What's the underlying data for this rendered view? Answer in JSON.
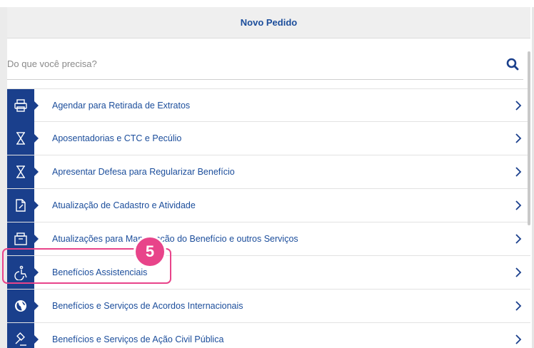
{
  "header": {
    "title": "Novo Pedido"
  },
  "search": {
    "placeholder": "Do que você precisa?"
  },
  "services": [
    {
      "label": "Agendar para Retirada de Extratos",
      "icon": "printer-icon"
    },
    {
      "label": "Aposentadorias e CTC e Pecúlio",
      "icon": "hourglass-icon"
    },
    {
      "label": "Apresentar Defesa para Regularizar Benefício",
      "icon": "hourglass-icon"
    },
    {
      "label": "Atualização de Cadastro e Atividade",
      "icon": "document-edit-icon"
    },
    {
      "label": "Atualizações para Manutenção do Benefício e outros Serviços",
      "icon": "archive-box-icon"
    },
    {
      "label": "Benefícios Assistenciais",
      "icon": "wheelchair-icon"
    },
    {
      "label": "Benefícios e Serviços de Acordos Internacionais",
      "icon": "globe-icon"
    },
    {
      "label": "Benefícios e Serviços de Ação Civil Pública",
      "icon": "gavel-icon"
    }
  ],
  "annotation": {
    "step": "5",
    "color": "#e8448a"
  },
  "colors": {
    "brand": "#1a3f8c",
    "link": "#1b4d9b"
  }
}
